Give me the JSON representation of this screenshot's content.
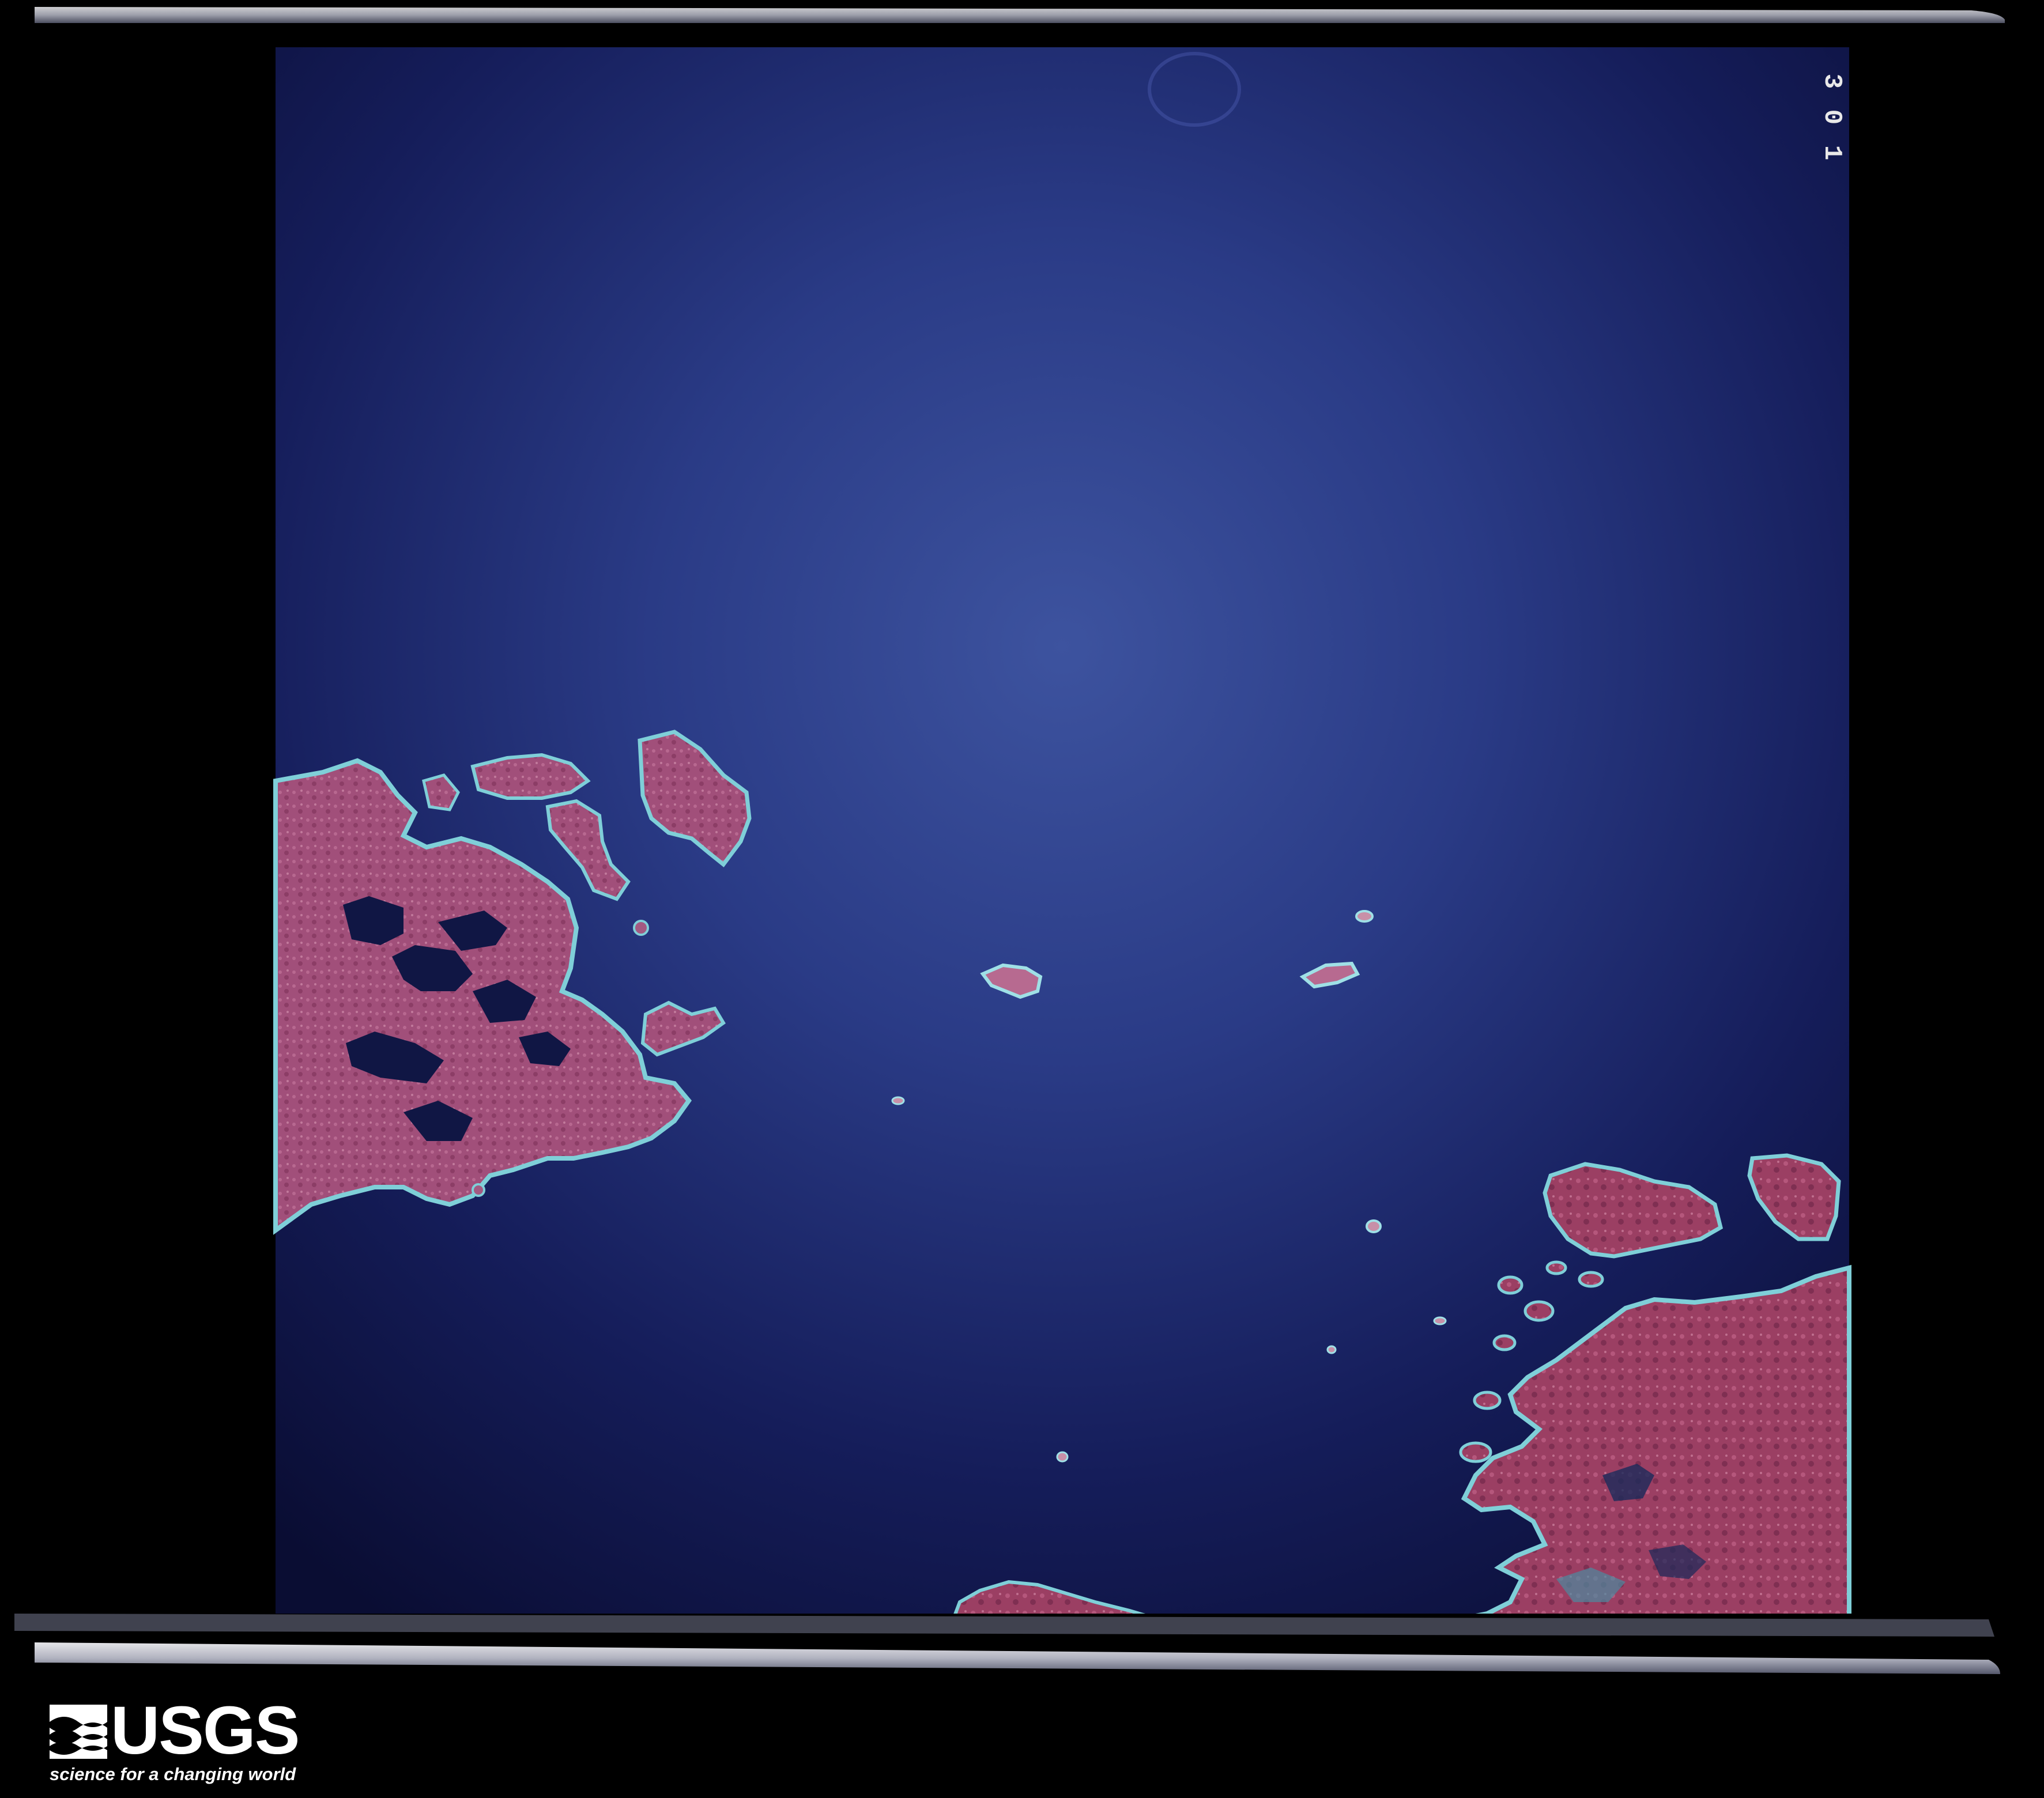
{
  "image": {
    "description_visible": "Aerial color-infrared film frame showing dark blue sea with reddish-pink islands and coastline",
    "film_frame_number_digits": [
      "3",
      "0",
      "1"
    ],
    "colors": {
      "background": "#000000",
      "sea_center": "#3b4f9c",
      "sea_edge": "#0b0f3a",
      "land": "#a8507a",
      "land_dark": "#8a3a5e",
      "shoreline": "#7fd0d8",
      "film_edge": "#d8d8e0"
    }
  },
  "logo": {
    "wordmark": "USGS",
    "tagline": "science for a changing world",
    "icon": "usgs-wave-icon"
  }
}
